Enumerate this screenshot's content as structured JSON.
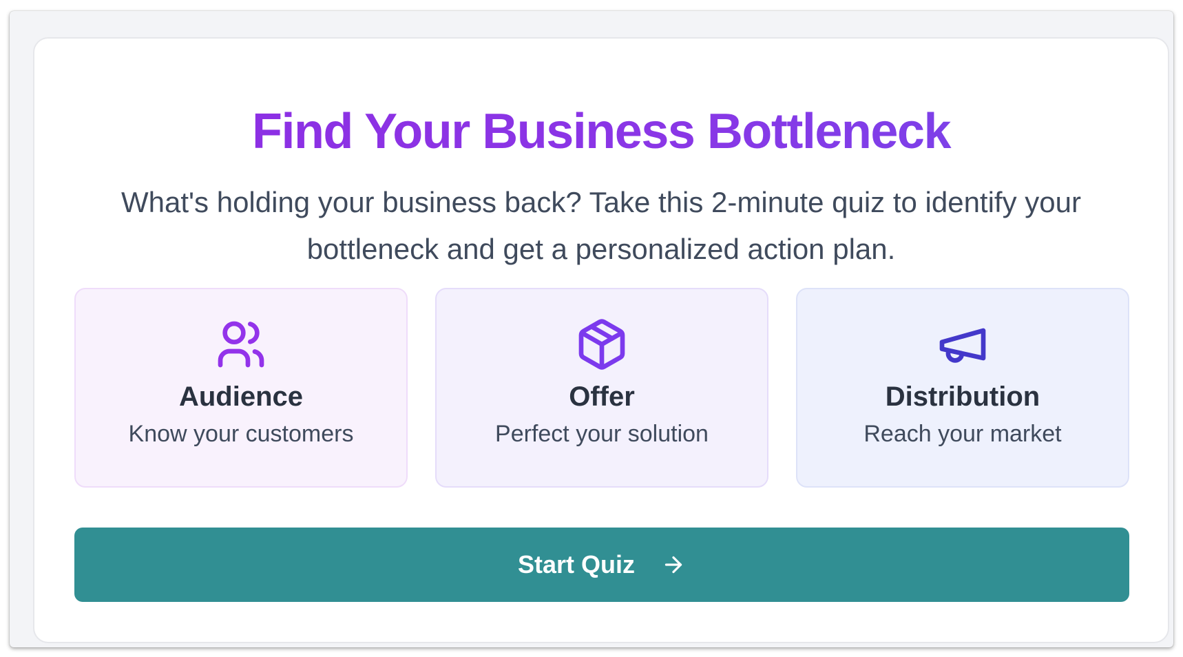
{
  "hero": {
    "title": "Find Your Business Bottleneck",
    "subtitle": "What's holding your business back? Take this 2-minute quiz to identify your bottleneck and get a personalized action plan."
  },
  "features": [
    {
      "icon": "users-icon",
      "title": "Audience",
      "description": "Know your customers",
      "color": "#9333ea"
    },
    {
      "icon": "package-icon",
      "title": "Offer",
      "description": "Perfect your solution",
      "color": "#7c3aed"
    },
    {
      "icon": "megaphone-icon",
      "title": "Distribution",
      "description": "Reach your market",
      "color": "#4338ca"
    }
  ],
  "cta": {
    "label": "Start Quiz",
    "icon": "arrow-right-icon",
    "color": "#318f93"
  },
  "colors": {
    "title_gradient_start": "#8e2de2",
    "title_gradient_end": "#7447ea",
    "text_dark": "#2a3240",
    "text_muted": "#3f4a5c"
  }
}
